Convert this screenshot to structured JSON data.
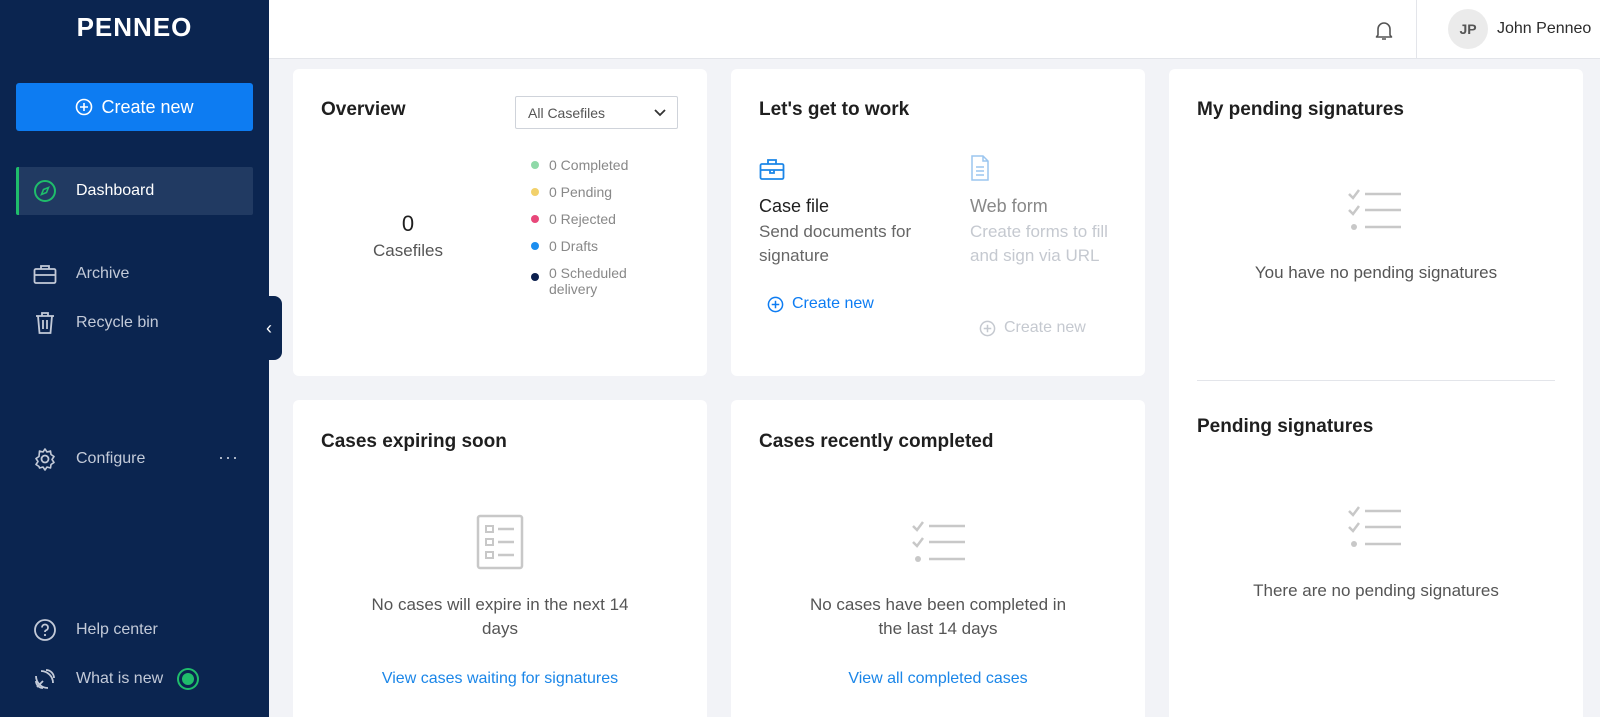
{
  "brand": {
    "logo": "PENNEO"
  },
  "sidebar": {
    "create_label": "Create new",
    "items": [
      {
        "label": "Dashboard",
        "icon": "compass-icon"
      },
      {
        "label": "Archive",
        "icon": "briefcase-icon"
      },
      {
        "label": "Recycle bin",
        "icon": "trash-icon"
      },
      {
        "label": "Configure",
        "icon": "gear-icon",
        "more": "···"
      },
      {
        "label": "Help center",
        "icon": "help-icon"
      },
      {
        "label": "What is new",
        "icon": "broadcast-icon"
      }
    ],
    "collapse": "‹"
  },
  "header": {
    "user_initials": "JP",
    "user_name": "John Penneo"
  },
  "overview": {
    "title": "Overview",
    "filter": "All Casefiles",
    "count": "0",
    "count_label": "Casefiles",
    "legend": [
      {
        "label": "0 Completed",
        "color": "#8fd9a8"
      },
      {
        "label": "0 Pending",
        "color": "#f2d16b"
      },
      {
        "label": "0 Rejected",
        "color": "#e8477a"
      },
      {
        "label": "0 Drafts",
        "color": "#1b8ef0"
      },
      {
        "label": "0 Scheduled delivery",
        "color": "#0b1f4d"
      }
    ]
  },
  "work": {
    "title": "Let's get to work",
    "case_file": {
      "title": "Case file",
      "desc": "Send documents for signature",
      "link": "Create new"
    },
    "web_form": {
      "title": "Web form",
      "desc": "Create forms to fill and sign via URL",
      "link": "Create new"
    }
  },
  "my_pending": {
    "title": "My pending signatures",
    "empty": "You have no pending signatures"
  },
  "pending": {
    "title": "Pending signatures",
    "empty": "There are no pending signatures"
  },
  "expiring": {
    "title": "Cases expiring soon",
    "empty": "No cases will expire in the next 14 days",
    "link": "View cases waiting for signatures"
  },
  "completed": {
    "title": "Cases recently completed",
    "empty": "No cases have been completed in the last 14 days",
    "link": "View all completed cases"
  }
}
